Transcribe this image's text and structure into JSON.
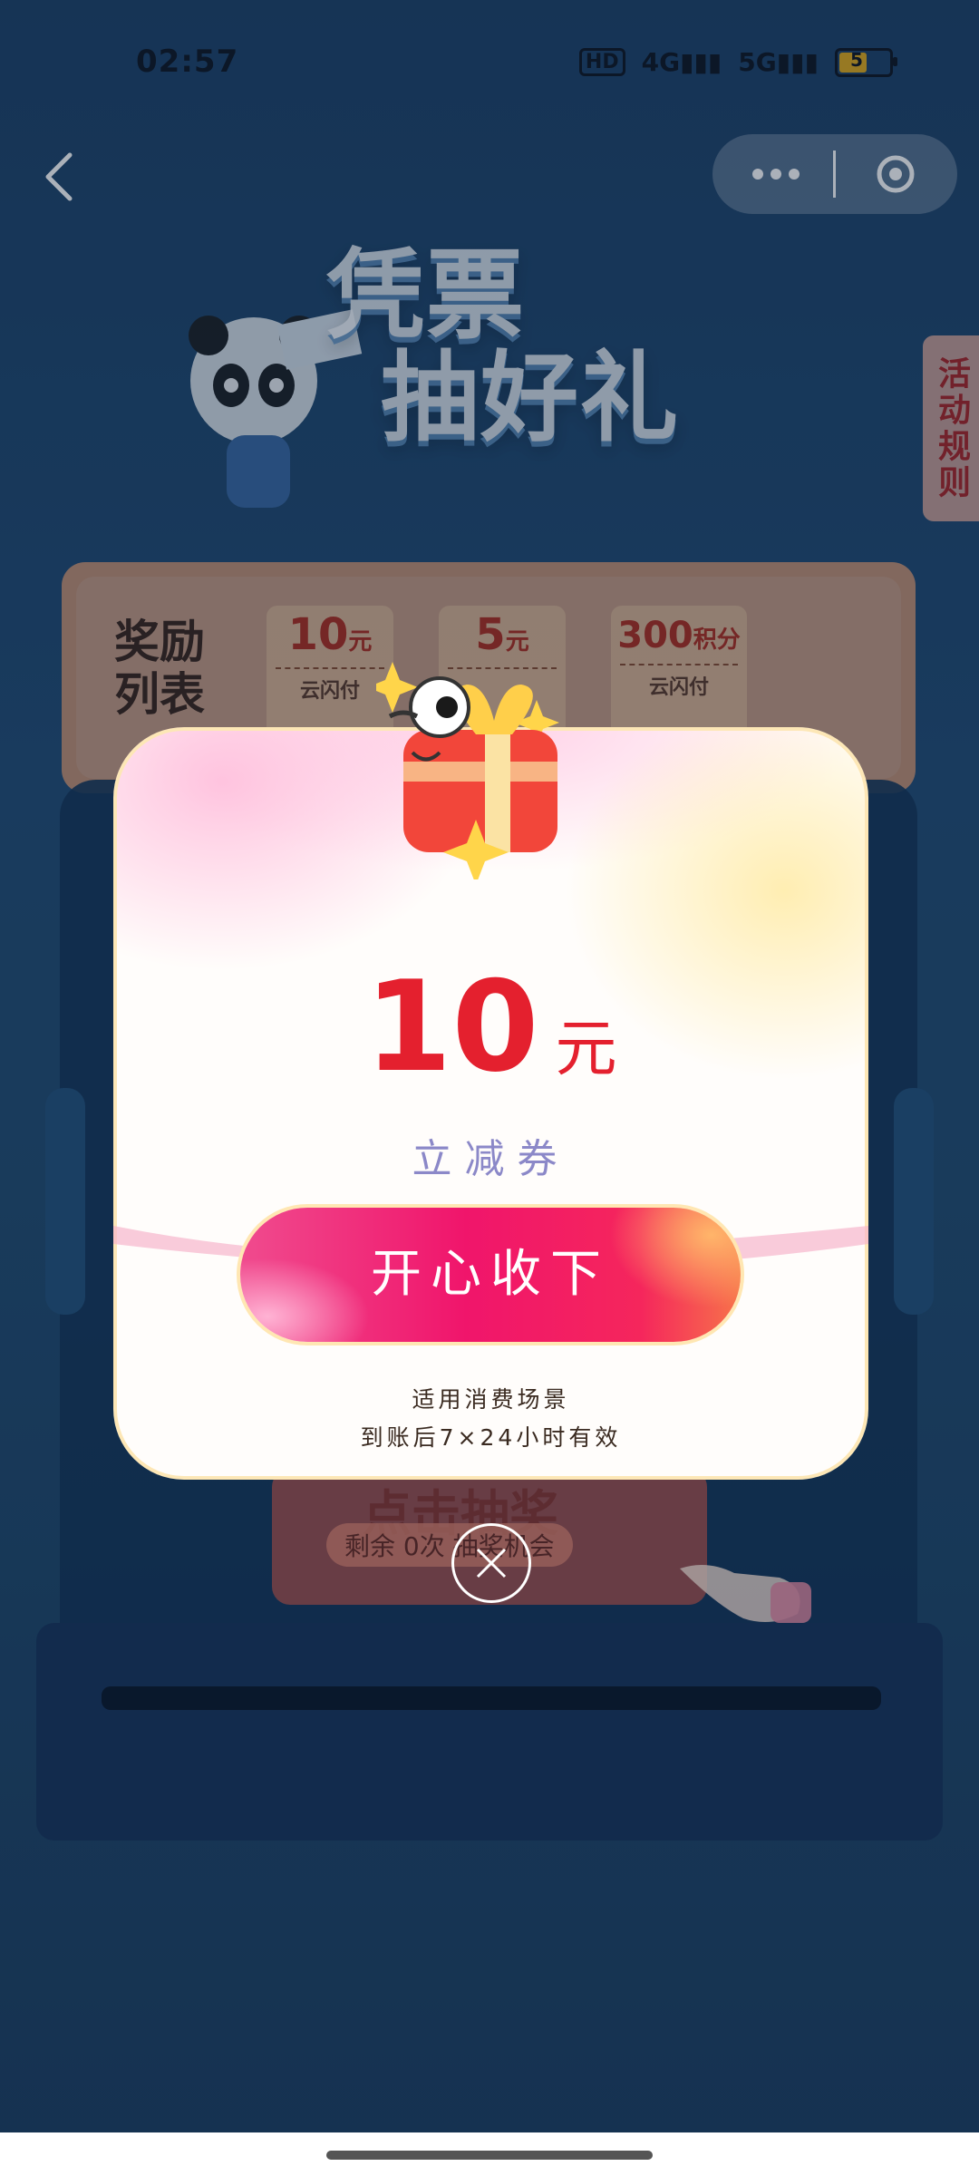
{
  "status_bar": {
    "time": "02:57",
    "hd": "HD",
    "signal1": "4G",
    "signal2": "5G",
    "battery": "5"
  },
  "nav": {
    "more_icon": "more-horizontal-icon",
    "close_icon": "close-circle-icon",
    "back_icon": "chevron-left-icon"
  },
  "hero": {
    "title_line1": "凭票",
    "title_line2": "抽好礼",
    "rules_tab": "活动规则"
  },
  "rewards": {
    "title": "奖励列表",
    "items": [
      {
        "amount": "10",
        "unit": "元",
        "sub": "云闪付"
      },
      {
        "amount": "5",
        "unit": "元",
        "sub": ""
      },
      {
        "amount": "300",
        "unit": "积分",
        "sub": "云闪付"
      }
    ]
  },
  "machine": {
    "draw_label": "点击抽奖",
    "draw_sub": "剩余 0次 抽奖机会"
  },
  "modal": {
    "amount": "10",
    "unit": "元",
    "coupon_type": "立减券",
    "accept_label": "开心收下",
    "note1": "适用消费场景",
    "note2": "到账后7×24小时有效"
  },
  "colors": {
    "accent": "#e4202e",
    "button_start": "#f04b8e",
    "button_end": "#f7734a"
  }
}
